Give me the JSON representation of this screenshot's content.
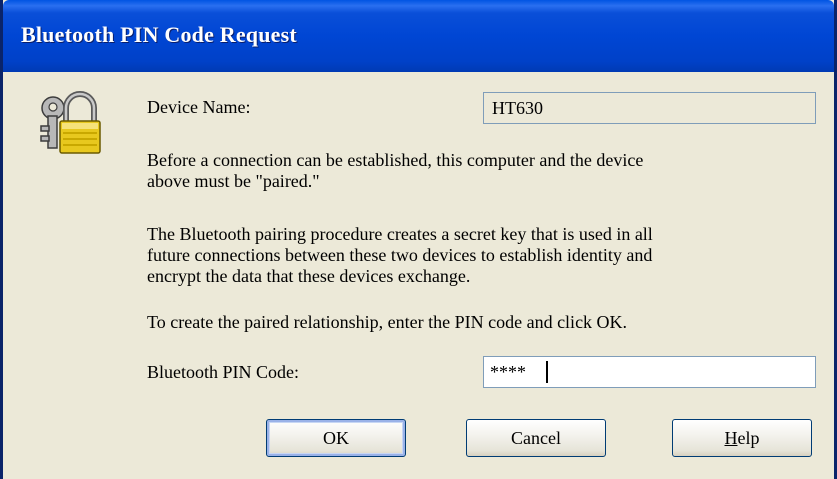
{
  "window": {
    "title": "Bluetooth PIN Code Request"
  },
  "icons": {
    "main": "lock-with-keys-icon"
  },
  "device": {
    "label": "Device Name:",
    "value": "HT630"
  },
  "messages": {
    "paragraph1_line1": "Before a connection can be established, this computer and the device",
    "paragraph1_line2": "above must be \"paired.\"",
    "paragraph2_line1": "The Bluetooth pairing procedure creates a secret key that is used in all",
    "paragraph2_line2": "future connections between these two devices to establish identity and",
    "paragraph2_line3": "encrypt the data that these devices exchange.",
    "instruction": "To create the paired relationship, enter the PIN code and click OK."
  },
  "pin": {
    "label": "Bluetooth PIN Code:",
    "value": "****"
  },
  "buttons": {
    "ok": "OK",
    "cancel": "Cancel",
    "help_first": "H",
    "help_rest": "elp"
  },
  "colors": {
    "titlebar": "#0046d4",
    "dialog_bg": "#ece9d8",
    "field_border": "#7f9db9"
  }
}
